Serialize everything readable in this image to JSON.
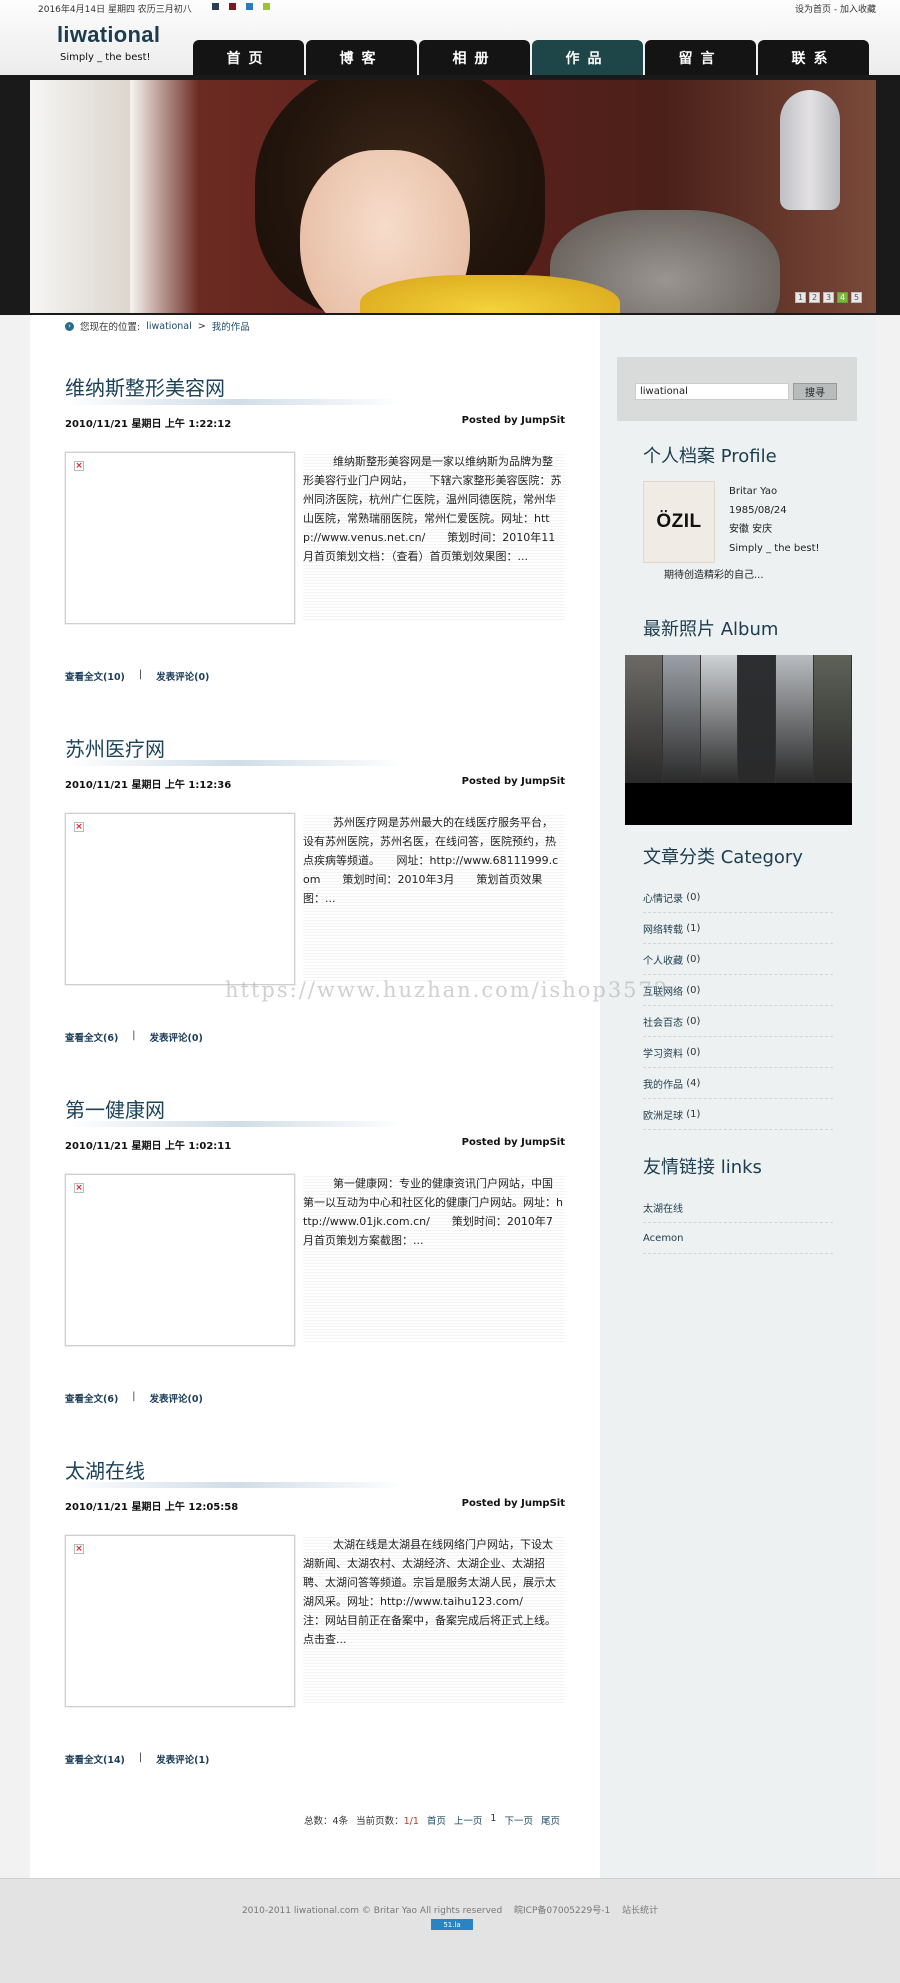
{
  "topbar": {
    "date": "2016年4月14日 星期四 农历三月初八",
    "swatch_colors": [
      "#2c3e50",
      "#7a1a1a",
      "#2b7bbf",
      "#9ac33a"
    ],
    "links": "设为首页 - 加入收藏"
  },
  "site": {
    "logo": "liwational",
    "slogan": "Simply _ the best!"
  },
  "nav": [
    {
      "label": "首页"
    },
    {
      "label": "博客"
    },
    {
      "label": "相册"
    },
    {
      "label": "作品",
      "active": true
    },
    {
      "label": "留言"
    },
    {
      "label": "联系"
    }
  ],
  "slider": {
    "pages": [
      "1",
      "2",
      "3",
      "4",
      "5"
    ],
    "current": "4"
  },
  "breadcrumb": {
    "prefix": "您现在的位置:",
    "home": "liwational",
    "separator": ">",
    "current": "我的作品"
  },
  "posts": [
    {
      "title": "维纳斯整形美容网",
      "date": "2010/11/21 星期日 上午 1:22:12",
      "author": "Posted by JumpSit",
      "excerpt": "维纳斯整形美容网是一家以维纳斯为品牌为整形美容行业门户网站，　　下辖六家整形美容医院：苏州同济医院，杭州广仁医院，温州同德医院，常州华山医院，常熟瑞丽医院，常州仁爱医院。网址：http://www.venus.net.cn/　　策划时间：2010年11月首页策划文档：（查看）首页策划效果图：...",
      "read_more": "查看全文(10)",
      "comment": "发表评论(0)"
    },
    {
      "title": "苏州医疗网",
      "date": "2010/11/21 星期日 上午 1:12:36",
      "author": "Posted by JumpSit",
      "excerpt": "苏州医疗网是苏州最大的在线医疗服务平台，设有苏州医院，苏州名医，在线问答，医院预约，热点疾病等频道。　　网址：http://www.68111999.com　　策划时间：2010年3月　　策划首页效果图：...",
      "read_more": "查看全文(6)",
      "comment": "发表评论(0)"
    },
    {
      "title": "第一健康网",
      "date": "2010/11/21 星期日 上午 1:02:11",
      "author": "Posted by JumpSit",
      "excerpt": "第一健康网：专业的健康资讯门户网站，中国第一以互动为中心和社区化的健康门户网站。网址：http://www.01jk.com.cn/　　策划时间：2010年7月首页策划方案截图：...",
      "read_more": "查看全文(6)",
      "comment": "发表评论(0)"
    },
    {
      "title": "太湖在线",
      "date": "2010/11/21 星期日 上午 12:05:58",
      "author": "Posted by JumpSit",
      "excerpt": "太湖在线是太湖县在线网络门户网站，下设太湖新闻、太湖农村、太湖经济、太湖企业、太湖招聘、太湖问答等频道。宗旨是服务太湖人民，展示太湖风采。网址：http://www.taihu123.com/　　注：网站目前正在备案中，备案完成后将正式上线。点击查...",
      "read_more": "查看全文(14)",
      "comment": "发表评论(1)"
    }
  ],
  "pager": {
    "total": "总数：4条",
    "pages_label": "当前页数：",
    "pages_value": "1/1",
    "first": "首页",
    "prev": "上一页",
    "page": "1",
    "next": "下一页",
    "last": "尾页"
  },
  "sidebar": {
    "search": {
      "value": "liwational",
      "button": "搜寻"
    },
    "profile": {
      "heading": "个人档案 Profile",
      "pic_text": "ÖZIL",
      "name": "Britar Yao",
      "birthday": "1985/08/24",
      "location": "安徽 安庆",
      "motto_short": "Simply _ the best!",
      "motto": "期待创造精彩的自己..."
    },
    "album": {
      "heading": "最新照片 Album",
      "slice_colors": [
        "#6d6a66",
        "#9ba0a6",
        "#cfd2d5",
        "#2c2e31",
        "#b9bcc0",
        "#5e6258"
      ]
    },
    "category": {
      "heading": "文章分类 Category",
      "items": [
        {
          "name": "心情记录",
          "count": "(0)"
        },
        {
          "name": "网络转载",
          "count": "(1)"
        },
        {
          "name": "个人收藏",
          "count": "(0)"
        },
        {
          "name": "互联网络",
          "count": "(0)"
        },
        {
          "name": "社会百态",
          "count": "(0)"
        },
        {
          "name": "学习资料",
          "count": "(0)"
        },
        {
          "name": "我的作品",
          "count": "(4)"
        },
        {
          "name": "欧洲足球",
          "count": "(1)"
        }
      ]
    },
    "links": {
      "heading": "友情链接 links",
      "items": [
        {
          "name": "太湖在线"
        },
        {
          "name": "Acemon"
        }
      ]
    }
  },
  "footer": {
    "text": "2010-2011 liwational.com © Britar Yao All rights reserved　 皖ICP备07005229号-1　 站长统计",
    "badge": "51.la"
  },
  "watermark": "https://www.huzhan.com/ishop3572"
}
